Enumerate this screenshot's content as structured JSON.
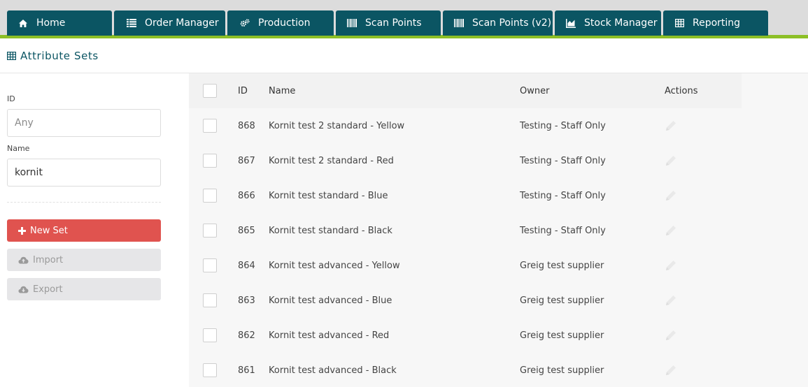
{
  "nav": {
    "tabs": [
      {
        "label": "Home",
        "icon": "home-icon"
      },
      {
        "label": "Order Manager",
        "icon": "list-icon"
      },
      {
        "label": "Production",
        "icon": "cogs-icon"
      },
      {
        "label": "Scan Points",
        "icon": "barcode-icon"
      },
      {
        "label": "Scan Points (v2)",
        "icon": "barcode-icon"
      },
      {
        "label": "Stock Manager",
        "icon": "chart-icon"
      },
      {
        "label": "Reporting",
        "icon": "table-icon"
      }
    ],
    "accent_color": "#8cbf26",
    "tab_color": "#0b5563"
  },
  "page": {
    "title": "Attribute Sets",
    "icon": "table-icon"
  },
  "filters": {
    "id_label": "ID",
    "id_placeholder": "Any",
    "id_value": "",
    "name_label": "Name",
    "name_value": "kornit"
  },
  "actions": {
    "new_set": "New Set",
    "import": "Import",
    "export": "Export"
  },
  "table": {
    "columns": {
      "id": "ID",
      "name": "Name",
      "owner": "Owner",
      "actions": "Actions"
    },
    "rows": [
      {
        "id": "868",
        "name": "Kornit test 2 standard - Yellow",
        "owner": "Testing - Staff Only"
      },
      {
        "id": "867",
        "name": "Kornit test 2 standard - Red",
        "owner": "Testing - Staff Only"
      },
      {
        "id": "866",
        "name": "Kornit test standard - Blue",
        "owner": "Testing - Staff Only"
      },
      {
        "id": "865",
        "name": "Kornit test standard - Black",
        "owner": "Testing - Staff Only"
      },
      {
        "id": "864",
        "name": "Kornit test advanced - Yellow",
        "owner": "Greig test supplier"
      },
      {
        "id": "863",
        "name": "Kornit test advanced - Blue",
        "owner": "Greig test supplier"
      },
      {
        "id": "862",
        "name": "Kornit test advanced - Red",
        "owner": "Greig test supplier"
      },
      {
        "id": "861",
        "name": "Kornit test advanced - Black",
        "owner": "Greig test supplier"
      }
    ]
  }
}
